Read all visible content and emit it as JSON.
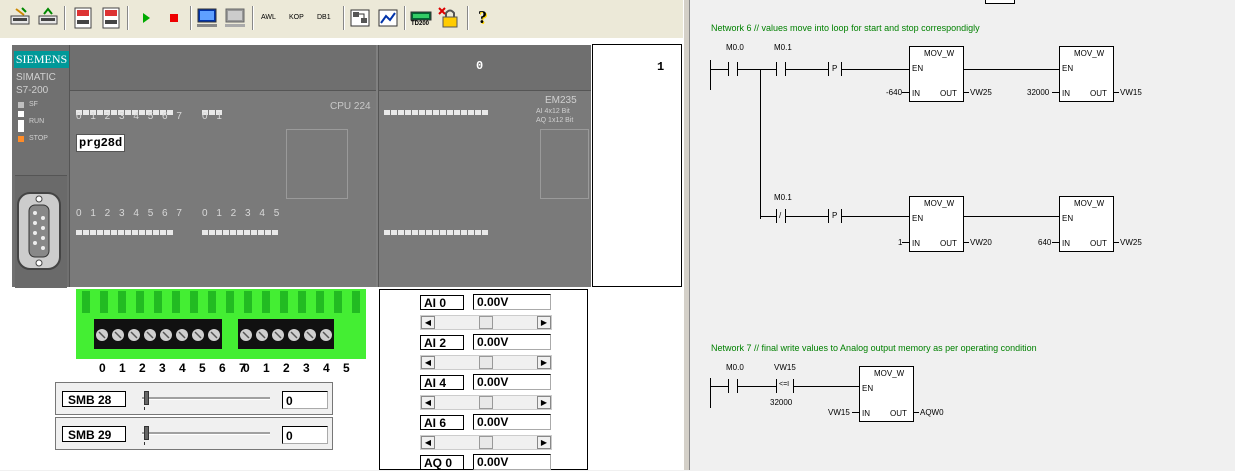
{
  "toolbar": {
    "buttons": [
      {
        "name": "open-program-icon"
      },
      {
        "name": "save-program-icon"
      },
      {
        "name": "load-cpu-icon"
      },
      {
        "name": "download-cpu-icon"
      },
      {
        "name": "run-icon"
      },
      {
        "name": "stop-icon"
      },
      {
        "name": "monitor-icon"
      },
      {
        "name": "monitor-disabled-icon"
      },
      {
        "name": "chart-icon"
      },
      {
        "name": "picture-icon"
      },
      {
        "name": "td200-icon"
      },
      {
        "name": "force-icon"
      },
      {
        "name": "help-icon"
      }
    ],
    "text_buttons": {
      "awl": "AWL",
      "kop": "KOP",
      "db1": "DB1"
    },
    "td_label": "TD200",
    "help_label": "?"
  },
  "plc": {
    "brand": "SIEMENS",
    "model_line1": "SIMATIC",
    "model_line2": "S7-200",
    "status": {
      "sf": "SF",
      "run": "RUN",
      "stop": "STOP"
    },
    "status_colors": {
      "stop": "#ff8c28",
      "run": "#ffffff",
      "sf": "#c0c0c0"
    },
    "cpu": "CPU 224",
    "program_name": "prg28d",
    "input_numbers": "0 1 2 3 4 5 6 7",
    "input_numbers_b": "0 1",
    "output_numbers": "0 1 2 3 4 5 6 7",
    "output_numbers_b": "0 1 2 3 4 5",
    "em_value": "0",
    "em_model": "EM235",
    "em_ai": "AI 4x12 Bit",
    "em_aq": "AQ 1x12 Bit",
    "right_value": "1"
  },
  "terminal": {
    "numbers_a": "0 1 2 3 4 5 6 7",
    "numbers_b": "0 1 2 3 4 5",
    "color": "#44ee33"
  },
  "smb": [
    {
      "label": "SMB 28",
      "value": "0",
      "level": 0
    },
    {
      "label": "SMB 29",
      "value": "0",
      "level": 0
    }
  ],
  "analog": [
    {
      "label": "AI 0",
      "value": "0.00V",
      "level": 0.5
    },
    {
      "label": "AI 2",
      "value": "0.00V",
      "level": 0.5
    },
    {
      "label": "AI 4",
      "value": "0.00V",
      "level": 0.5
    },
    {
      "label": "AI 6",
      "value": "0.00V",
      "level": 0.5
    },
    {
      "label": "AQ 0",
      "value": "0.00V"
    }
  ],
  "ladder": {
    "net6": {
      "comment": "Network 6 // values move into loop for start and stop correspondigly",
      "c1": "M0.0",
      "c2": "M0.1",
      "c3": "M0.1",
      "p": "P",
      "neg": "/",
      "b1": {
        "title": "MOV_W",
        "en": "EN",
        "in": "IN",
        "out": "OUT",
        "in_val": "-640",
        "out_val": "VW25"
      },
      "b2": {
        "title": "MOV_W",
        "en": "EN",
        "in": "IN",
        "out": "OUT",
        "in_val": "32000",
        "out_val": "VW15"
      },
      "b3": {
        "title": "MOV_W",
        "en": "EN",
        "in": "IN",
        "out": "OUT",
        "in_val": "1",
        "out_val": "VW20"
      },
      "b4": {
        "title": "MOV_W",
        "en": "EN",
        "in": "IN",
        "out": "OUT",
        "in_val": "640",
        "out_val": "VW25"
      }
    },
    "net7": {
      "comment": "Network 7 // final write values to Analog output memory as per operating condition",
      "c1": "M0.0",
      "cmp_top": "VW15",
      "cmp_op": "<=I",
      "cmp_bottom": "32000",
      "b1": {
        "title": "MOV_W",
        "en": "EN",
        "in": "IN",
        "out": "OUT",
        "in_val": "VW15",
        "out_val": "AQW0"
      }
    }
  }
}
